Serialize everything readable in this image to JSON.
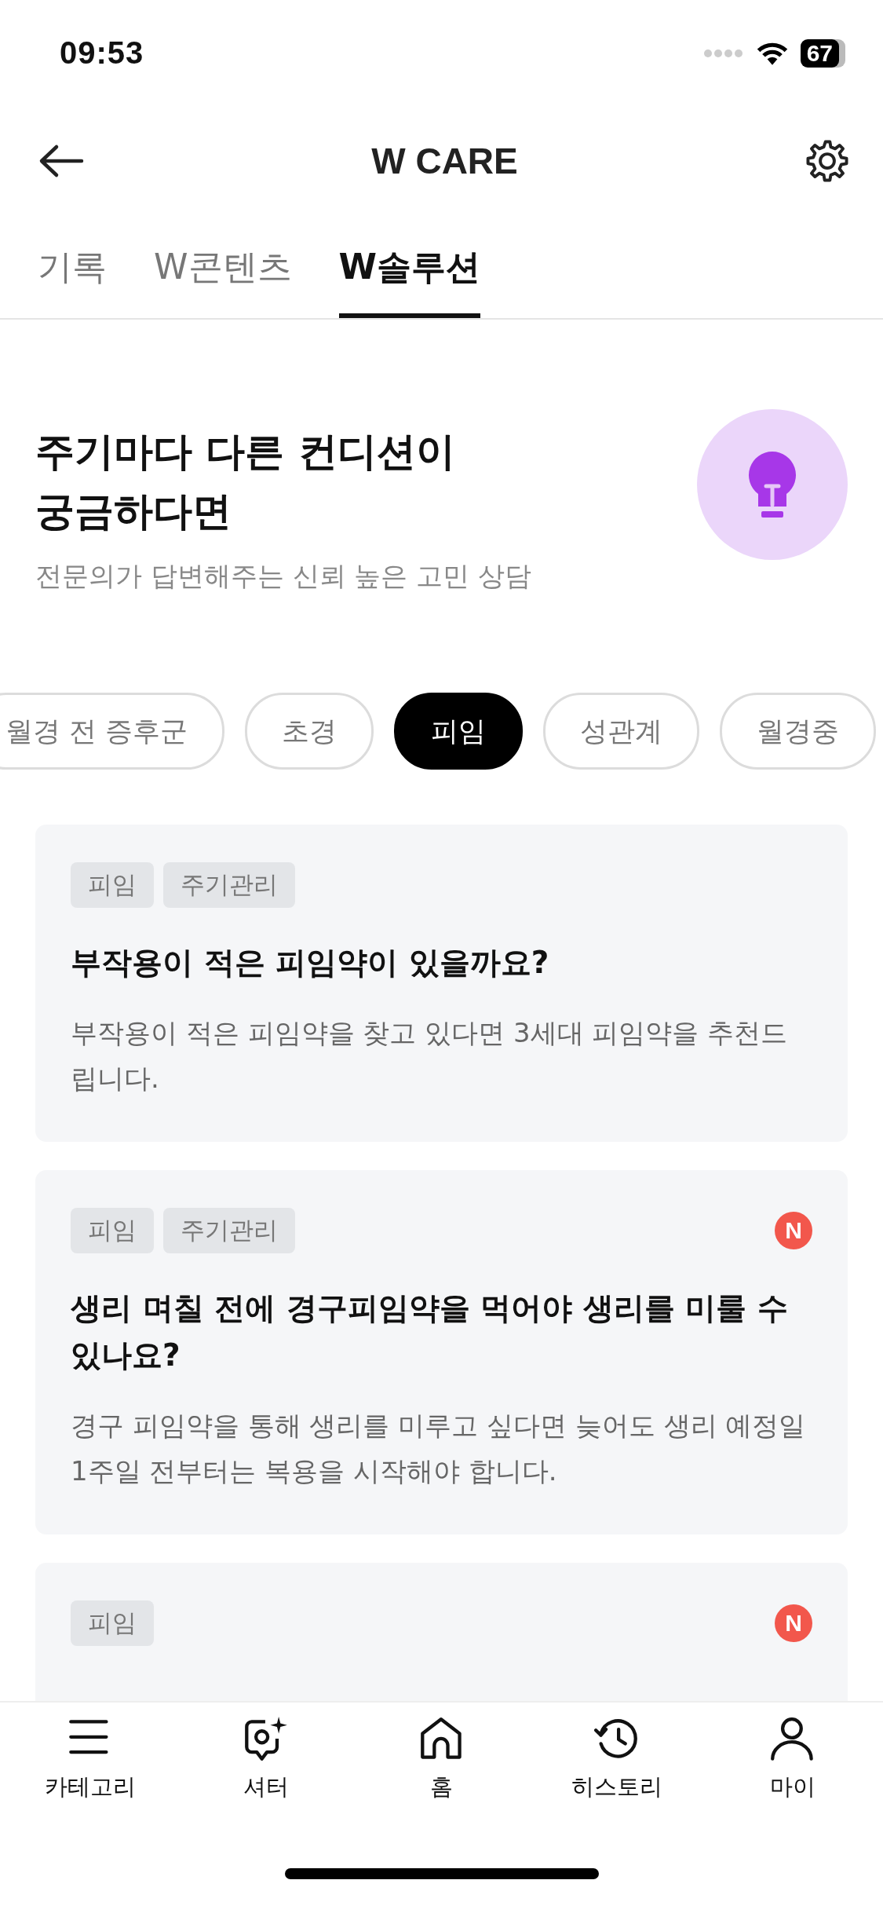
{
  "status_bar": {
    "time": "09:53",
    "battery": "67"
  },
  "header": {
    "title": "W CARE"
  },
  "tabs": [
    {
      "label": "기록",
      "selected": false
    },
    {
      "label": "W콘텐츠",
      "selected": false
    },
    {
      "label": "W솔루션",
      "selected": true
    }
  ],
  "hero": {
    "heading": "주기마다 다른 컨디션이\n궁금하다면",
    "subtitle": "전문의가 답변해주는 신뢰 높은 고민 상담"
  },
  "chips": [
    {
      "label": "월경 전 증후군",
      "selected": false
    },
    {
      "label": "초경",
      "selected": false
    },
    {
      "label": "피임",
      "selected": true
    },
    {
      "label": "성관계",
      "selected": false
    },
    {
      "label": "월경중",
      "selected": false
    }
  ],
  "cards": [
    {
      "tags": [
        "피임",
        "주기관리"
      ],
      "new": false,
      "title": "부작용이 적은 피임약이 있을까요?",
      "body": "부작용이 적은 피임약을 찾고 있다면 3세대 피임약을 추천드립니다."
    },
    {
      "tags": [
        "피임",
        "주기관리"
      ],
      "new": true,
      "badge": "N",
      "title": "생리 며칠 전에 경구피임약을 먹어야 생리를 미룰 수 있나요?",
      "body": "경구 피임약을 통해 생리를 미루고 싶다면 늦어도 생리 예정일 1주일 전부터는 복용을 시작해야 합니다."
    },
    {
      "tags": [
        "피임"
      ],
      "new": true,
      "badge": "N"
    }
  ],
  "bottom_nav": [
    {
      "label": "카테고리"
    },
    {
      "label": "셔터"
    },
    {
      "label": "홈"
    },
    {
      "label": "히스토리"
    },
    {
      "label": "마이"
    }
  ]
}
